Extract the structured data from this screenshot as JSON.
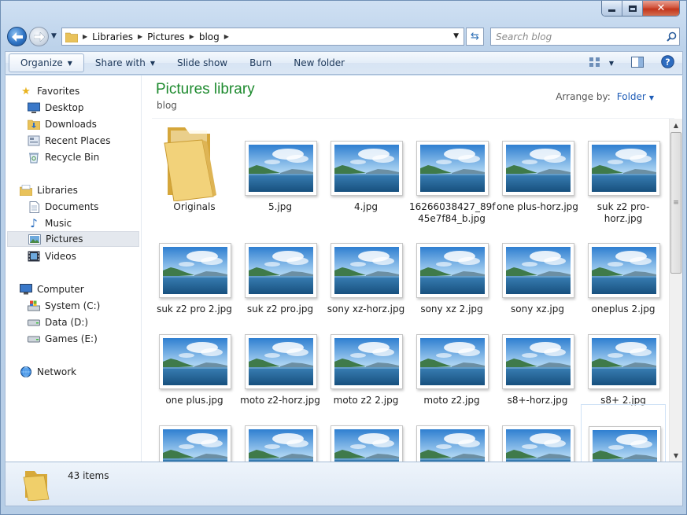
{
  "address": {
    "crumbs": [
      "Libraries",
      "Pictures",
      "blog"
    ]
  },
  "search": {
    "placeholder": "Search blog"
  },
  "toolbar": {
    "organize": "Organize",
    "share_with": "Share with",
    "slide_show": "Slide show",
    "burn": "Burn",
    "new_folder": "New folder"
  },
  "sidebar": {
    "favorites": "Favorites",
    "desktop": "Desktop",
    "downloads": "Downloads",
    "recent_places": "Recent Places",
    "recycle_bin": "Recycle Bin",
    "libraries": "Libraries",
    "documents": "Documents",
    "music": "Music",
    "pictures": "Pictures",
    "videos": "Videos",
    "computer": "Computer",
    "system": "System (C:)",
    "data": "Data (D:)",
    "games": "Games (E:)",
    "network": "Network"
  },
  "main": {
    "title": "Pictures library",
    "subtitle": "blog",
    "arrange_label": "Arrange by:",
    "arrange_value": "Folder"
  },
  "items": [
    {
      "label": "Originals",
      "kind": "folder"
    },
    {
      "label": "5.jpg"
    },
    {
      "label": "4.jpg"
    },
    {
      "label": "16266038427_89f 45e7f84_b.jpg"
    },
    {
      "label": "one plus-horz.jpg"
    },
    {
      "label": "suk z2 pro-horz.jpg"
    },
    {
      "label": "suk z2 pro 2.jpg"
    },
    {
      "label": "suk z2 pro.jpg"
    },
    {
      "label": "sony xz-horz.jpg"
    },
    {
      "label": "sony xz 2.jpg"
    },
    {
      "label": "sony xz.jpg"
    },
    {
      "label": "oneplus 2.jpg"
    },
    {
      "label": "one plus.jpg"
    },
    {
      "label": "moto z2-horz.jpg"
    },
    {
      "label": "moto z2 2.jpg"
    },
    {
      "label": "moto z2.jpg"
    },
    {
      "label": "s8+-horz.jpg"
    },
    {
      "label": "s8+ 2.jpg"
    },
    {
      "label": ""
    },
    {
      "label": ""
    },
    {
      "label": ""
    },
    {
      "label": ""
    },
    {
      "label": ""
    },
    {
      "label": ""
    }
  ],
  "status": {
    "count": "43 items"
  },
  "colors": {
    "title_green": "#1d8a2e",
    "link_blue": "#1f5db7"
  }
}
